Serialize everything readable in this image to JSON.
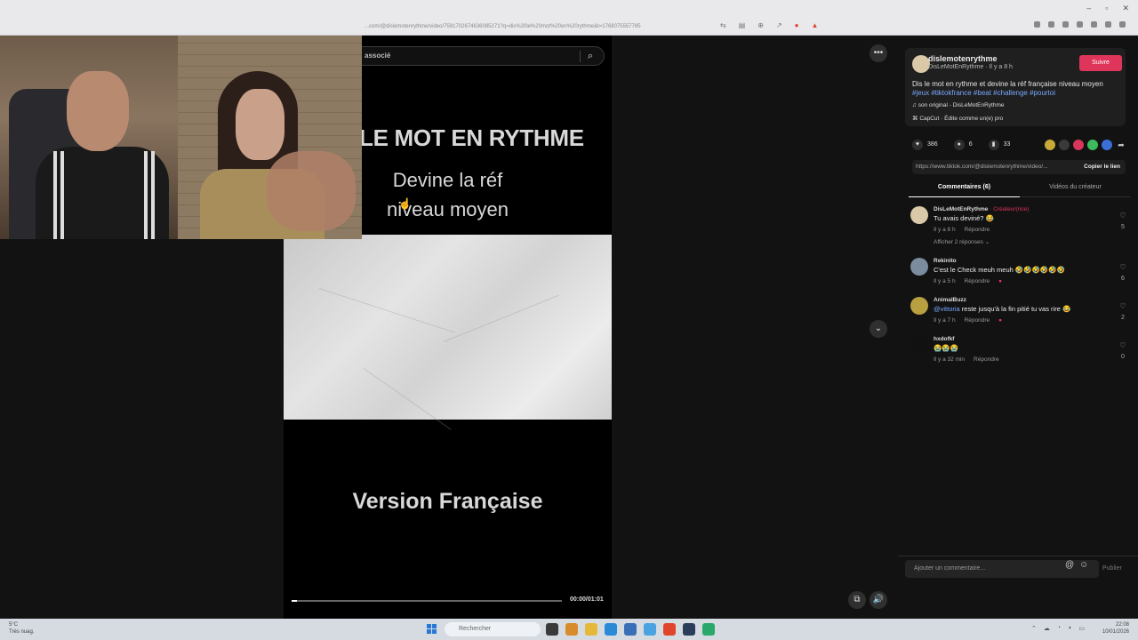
{
  "browser": {
    "url": "...com/@dislemotenrythme/video/7591702674636085271?q=dis%20le%20mot%20en%20rythme&t=1768075557785",
    "window_controls": [
      "–",
      "▫",
      "✕"
    ]
  },
  "video": {
    "search_text": "associé",
    "title_line": "LE MOT EN RYTHME",
    "subtitle_1": "Devine la réf",
    "subtitle_2": "niveau moyen",
    "bottom_text": "Version Française",
    "time": "00:00/01:01",
    "progress": 0.02
  },
  "post": {
    "author": "dislemotenrythme",
    "author_sub": "DisLeMotEnRythme · Il y a 8 h",
    "follow_label": "Suivre",
    "description": "Dis le mot en rythme et devine la réf française niveau moyen",
    "tags": "#jeux #tiktokfrance #beat #challenge #pourtoi",
    "music": "son original - DisLeMotEnRythme",
    "capcut": "CapCut · Édite comme un(e) pro",
    "likes": "386",
    "comments": "6",
    "saves": "33",
    "link": "https://www.tiktok.com/@dislemotenrythme/video/...",
    "copy_label": "Copier le lien",
    "tab_comments": "Commentaires (6)",
    "tab_videos": "Vidéos du créateur"
  },
  "comments": [
    {
      "user": "DisLeMotEnRythme",
      "badge": "· Créateur(rice)",
      "text": "Tu avais deviné? 😂",
      "time": "Il y a 8 h",
      "reply": "Répondre",
      "likes": "5",
      "replies": "Afficher 2 réponses ⌄",
      "color": "#d9c9a8"
    },
    {
      "user": "Rekinito",
      "badge": "",
      "text": "C'est le Check meuh meuh 🤣🤣🤣🤣🤣🤣",
      "time": "Il y a 5 h",
      "reply": "Répondre",
      "likes": "6",
      "replies": "",
      "color": "#7a8c9e"
    },
    {
      "user": "AnimalBuzz",
      "badge": "",
      "mention": "@vittoria",
      "text": " reste jusqu'à la fin pitié tu vas rire 😂",
      "time": "Il y a 7 h",
      "reply": "Répondre",
      "likes": "2",
      "replies": "",
      "color": "#b8a040"
    },
    {
      "user": "hxdofkf",
      "badge": "",
      "text": "😭😭😭",
      "time": "Il y a 32 min",
      "reply": "Répondre",
      "likes": "0",
      "replies": "",
      "color": "#111"
    }
  ],
  "composer": {
    "placeholder": "Ajouter un commentaire...",
    "publish": "Publier"
  },
  "taskbar": {
    "temp": "5°C",
    "weather": "Très nuag.",
    "search": "Rechercher",
    "time": "22:08",
    "date": "10/01/2026"
  }
}
